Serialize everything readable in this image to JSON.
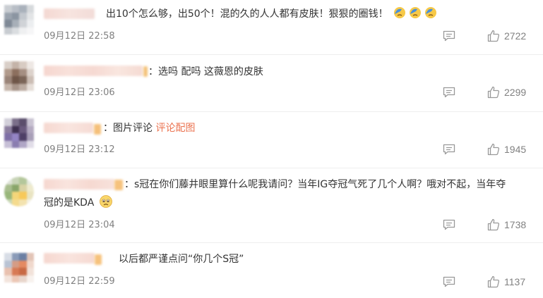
{
  "comments": [
    {
      "text": "出10个怎么够，出50个！混的久的人人都有皮肤！狠狠的圈钱！",
      "emojis": [
        "facepalm-emoji",
        "facepalm-emoji",
        "facepalm-emoji"
      ],
      "time": "09月12日 22:58",
      "likes": "2722"
    },
    {
      "text": "：选吗 配吗 这薇恩的皮肤",
      "time": "09月12日 23:06",
      "likes": "2299"
    },
    {
      "text": "：图片评论 ",
      "link": "评论配图",
      "time": "09月12日 23:12",
      "likes": "1945"
    },
    {
      "text_line1": "：s冠在你们藤井眼里算什么呢我请问？当年IG夺冠气死了几个人啊？哦对不起，当年夺",
      "text_line2": "冠的是KDA",
      "emojis": [
        "sad-emoji"
      ],
      "time": "09月12日 23:04",
      "likes": "1738"
    },
    {
      "text": "以后都严谨点问“你几个S冠”",
      "time": "09月12日 22:59",
      "likes": "1137"
    }
  ],
  "colors": {
    "text": "#333333",
    "meta": "#808080",
    "link": "#eb7350",
    "divider": "#eeeeee"
  }
}
